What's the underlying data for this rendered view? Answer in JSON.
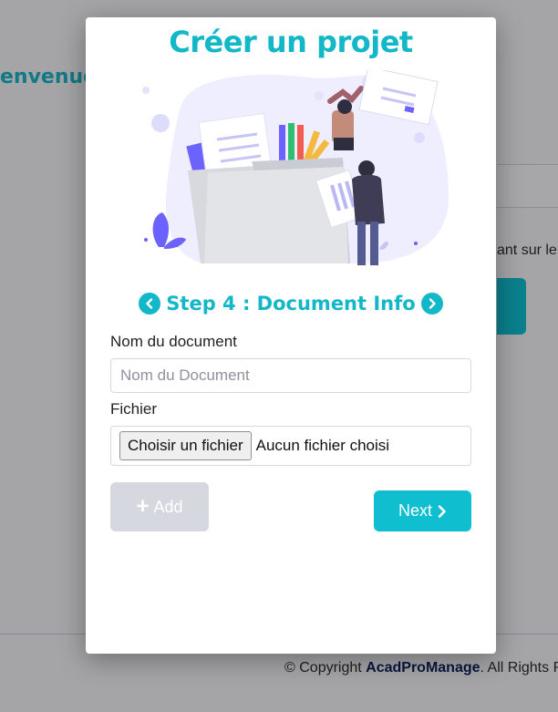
{
  "background": {
    "welcome_text": "envenue",
    "side_text": "ant sur le",
    "footer_prefix": "© Copyright ",
    "footer_brand": "AcadProManage",
    "footer_suffix": ". All Rights R"
  },
  "modal": {
    "title": "Créer un projet",
    "step_title": "Step 4 : Document Info",
    "document_name_label": "Nom du document",
    "document_name_placeholder": "Nom du Document",
    "document_name_value": "",
    "file_label": "Fichier",
    "file_button_label": "Choisir un fichier",
    "file_status": "Aucun fichier choisi",
    "add_label": "Add",
    "next_label": "Next"
  },
  "icons": {
    "prev": "chevron-left-circle-icon",
    "next": "chevron-right-circle-icon",
    "plus": "plus-icon",
    "next_chevron": "chevron-right-icon"
  },
  "colors": {
    "accent": "#12b7c8",
    "button": "#10bfcf",
    "disabled": "#d5d8de",
    "illustration_purple": "#6c63ff"
  }
}
